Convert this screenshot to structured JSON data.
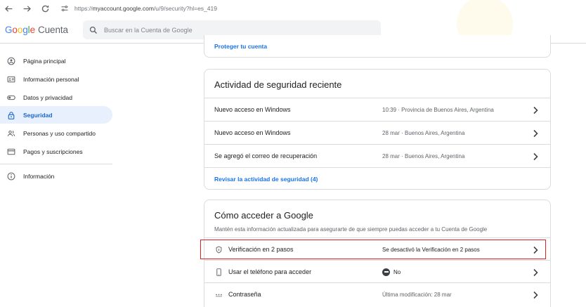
{
  "browser": {
    "url_prefix": "https://",
    "url_main": "myaccount.google.com",
    "url_suffix": "/u/9/security?hl=es_419"
  },
  "header": {
    "logo_g": "G",
    "logo_o1": "o",
    "logo_o2": "o",
    "logo_g2": "g",
    "logo_l": "l",
    "logo_e": "e",
    "product": "Cuenta",
    "search_placeholder": "Buscar en la Cuenta de Google"
  },
  "sidebar": {
    "items": [
      {
        "label": "Página principal",
        "icon": "person-circle-icon"
      },
      {
        "label": "Información personal",
        "icon": "id-card-icon"
      },
      {
        "label": "Datos y privacidad",
        "icon": "toggle-icon"
      },
      {
        "label": "Seguridad",
        "icon": "lock-icon",
        "active": true
      },
      {
        "label": "Personas y uso compartido",
        "icon": "people-icon"
      },
      {
        "label": "Pagos y suscripciones",
        "icon": "credit-card-icon"
      },
      {
        "label": "Información",
        "icon": "info-icon"
      }
    ]
  },
  "protect": {
    "link": "Proteger tu cuenta"
  },
  "activity": {
    "title": "Actividad de seguridad reciente",
    "rows": [
      {
        "label": "Nuevo acceso en Windows",
        "value": "10:39 · Provincia de Buenos Aires, Argentina"
      },
      {
        "label": "Nuevo acceso en Windows",
        "value": "28 mar · Buenos Aires, Argentina"
      },
      {
        "label": "Se agregó el correo de recuperación",
        "value": "28 mar · Buenos Aires, Argentina"
      }
    ],
    "link": "Revisar la actividad de seguridad (4)"
  },
  "access": {
    "title": "Cómo acceder a Google",
    "subtitle": "Mantén esta información actualizada para asegurarte de que siempre puedas acceder a tu Cuenta de Google",
    "rows": [
      {
        "label": "Verificación en 2 pasos",
        "value": "Se desactivó la Verificación en 2 pasos",
        "icon": "shield-icon"
      },
      {
        "label": "Usar el teléfono para acceder",
        "value": "No",
        "icon": "phone-icon"
      },
      {
        "label": "Contraseña",
        "value": "Última modificación: 28 mar",
        "icon": "password-dots-icon"
      }
    ]
  },
  "colors": {
    "accent": "#1a73e8",
    "active_bg": "#e8f0fe",
    "highlight": "#e02020"
  }
}
